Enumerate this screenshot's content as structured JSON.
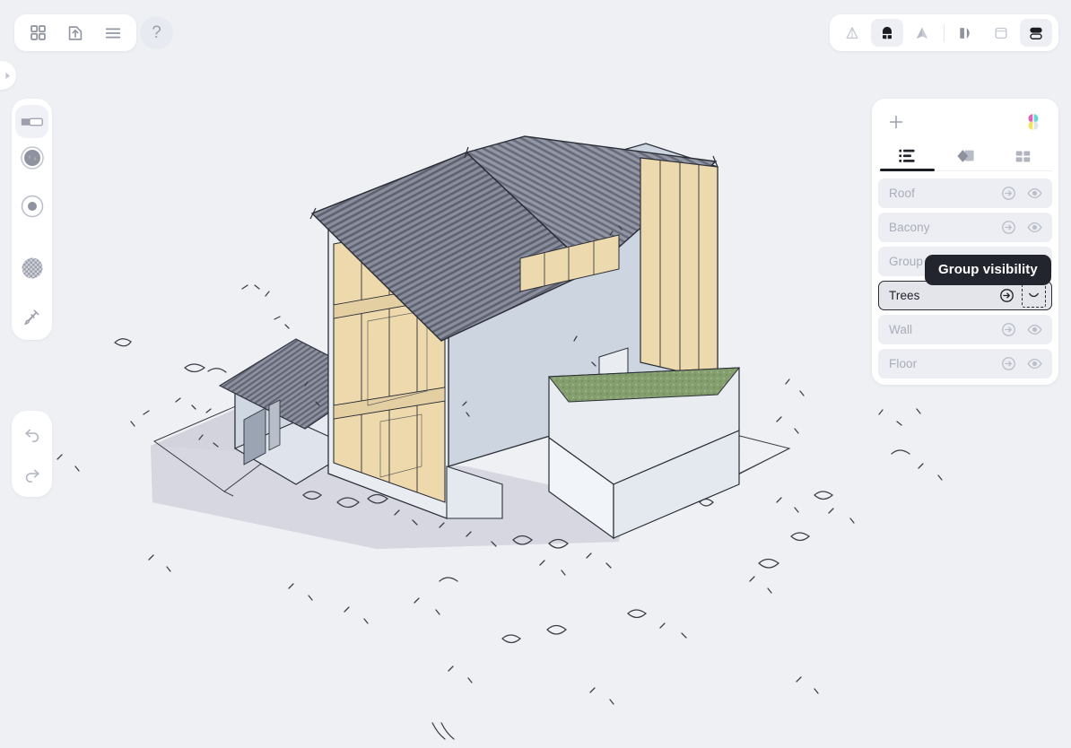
{
  "app": {
    "background_color": "#eef0f4",
    "accent_color": "#1b1d24"
  },
  "top_left_toolbar": {
    "buttons": [
      {
        "name": "grid-icon",
        "label": "Grid"
      },
      {
        "name": "export-icon",
        "label": "Export"
      },
      {
        "name": "menu-icon",
        "label": "Menu"
      }
    ],
    "help_label": "?"
  },
  "top_right_toolbar": {
    "buttons": [
      {
        "name": "cone-view-icon",
        "label": "Perspective",
        "active": false
      },
      {
        "name": "shaded-box-icon",
        "label": "Shaded",
        "active": true
      },
      {
        "name": "filled-cone-icon",
        "label": "Solid",
        "active": false
      },
      {
        "name": "mirror-icon",
        "label": "Mirror",
        "active": false
      },
      {
        "name": "frame-icon",
        "label": "Frame",
        "active": false
      },
      {
        "name": "split-view-icon",
        "label": "Split view",
        "active": true
      }
    ]
  },
  "left_rail": {
    "tools": [
      {
        "name": "slider-tool-icon",
        "label": "Slider",
        "selected": true
      },
      {
        "name": "sphere-tool-icon",
        "label": "Sphere",
        "selected": false
      },
      {
        "name": "point-tool-icon",
        "label": "Point",
        "selected": false
      },
      {
        "name": "checker-tool-icon",
        "label": "Texture",
        "selected": false
      },
      {
        "name": "syringe-tool-icon",
        "label": "Eyedropper",
        "selected": false
      }
    ],
    "history": [
      {
        "name": "undo-icon",
        "label": "Undo"
      },
      {
        "name": "redo-icon",
        "label": "Redo"
      }
    ],
    "expander_label": "Expand"
  },
  "panel": {
    "add_label": "+",
    "palette_label": "Palette",
    "palette_colors": [
      "#e35fbb",
      "#5fd8d8",
      "#f2e45c",
      "#e1e4ea"
    ],
    "tabs": [
      {
        "name": "tab-layers",
        "icon": "list-icon",
        "label": "Layers",
        "active": true
      },
      {
        "name": "tab-materials",
        "icon": "shapes-icon",
        "label": "Materials",
        "active": false
      },
      {
        "name": "tab-assets",
        "icon": "grid-icon",
        "label": "Assets",
        "active": false
      }
    ],
    "layers": [
      {
        "label": "Roof",
        "selected": false,
        "visible": true
      },
      {
        "label": "Bacony",
        "selected": false,
        "visible": true
      },
      {
        "label": "Group 1",
        "selected": false,
        "visible": true
      },
      {
        "label": "Trees",
        "selected": true,
        "visible": false
      },
      {
        "label": "Wall",
        "selected": false,
        "visible": true
      },
      {
        "label": "Floor",
        "selected": false,
        "visible": true
      }
    ],
    "row_icons": {
      "enter_group": "enter-group-icon",
      "visibility": "eye-icon",
      "visibility_off": "eye-closed-icon"
    }
  },
  "tooltip": {
    "text": "Group visibility"
  },
  "viewport": {
    "scene_label": "3D house model",
    "colors": {
      "wall": "#cfd8e2",
      "wall_light": "#e8ecf1",
      "roof_dark": "#6d7180",
      "glass": "#f0dcb0",
      "wood": "#e8cf9f",
      "grass": "#7f9c6d",
      "shadow": "#bcbdcb"
    }
  }
}
